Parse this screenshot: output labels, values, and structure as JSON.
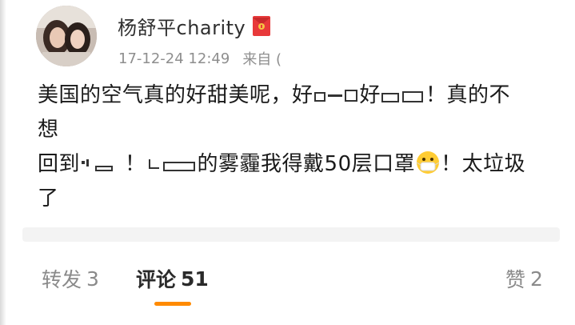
{
  "post": {
    "author": "杨舒平charity",
    "time": "17-12-24 12:49",
    "source": "来自 (",
    "lines": [
      [
        "美国的空气真的好甜美呢，好",
        {
          "g": "▭▬▭"
        },
        "好",
        {
          "g": "▭▬"
        },
        "！真的不"
      ],
      [
        "想"
      ],
      [
        "回到",
        {
          "g": "▫。▬"
        },
        "！",
        {
          "g": "└▬"
        },
        "的雾霾我得戴50层口罩",
        {
          "emoji": "mask-face-emoji"
        },
        "！太垃圾"
      ],
      [
        "了"
      ]
    ],
    "line_text": [
      "美国的空气真的好甜美呢，好",
      "好",
      "！真的不",
      "想",
      "回到",
      "！",
      "的雾霾我得戴50层口罩",
      "！太垃圾",
      "了"
    ]
  },
  "actions": {
    "repost_label": "转发",
    "repost_count": "3",
    "comment_label": "评论",
    "comment_count": "51",
    "like_label": "赞",
    "like_count": "2"
  },
  "colors": {
    "accent": "#ff8a00",
    "badge_red": "#e8393a",
    "badge_gold": "#f6c343",
    "text": "#1a1a1a",
    "muted": "#8e8e8e"
  },
  "icons": {
    "badge": "red-envelope-icon",
    "emoji": "mask-face-emoji"
  }
}
